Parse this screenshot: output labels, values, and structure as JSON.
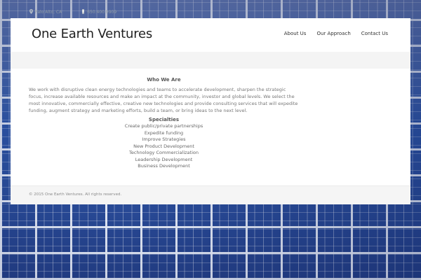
{
  "topbar": {
    "location": "Palo Alto, CA",
    "phone": "650.400.9909",
    "location_icon": "map-pin-icon",
    "phone_icon": "phone-icon"
  },
  "header": {
    "brand": "One Earth Ventures",
    "nav": [
      "About Us",
      "Our Approach",
      "Contact Us"
    ]
  },
  "main": {
    "heading": "Who We Are",
    "paragraph": "We work with disruptive clean energy technologies and teams to accelerate development, sharpen the strategic focus, increase available resources and make an impact at the community, investor and global levels. We select the most innovative, commercially effective, creative new technologies and provide consulting services that will expedite funding, augment strategy and marketing efforts, build a team, or bring ideas to the next level.",
    "specialties_heading": "Specialties",
    "specialties": [
      "Create public/private partnerships",
      "Expedite funding",
      "Improve Strategies",
      "New Product Development",
      "Technology Commercialization",
      "Leadership Development",
      "Business Development"
    ]
  },
  "footer": {
    "copyright": "© 2015 One Earth Ventures. All rights reserved."
  },
  "colors": {
    "background_panels": "#2c52a6",
    "panel_grid": "#ebf0fa",
    "text_dark": "#1f1f1f"
  }
}
